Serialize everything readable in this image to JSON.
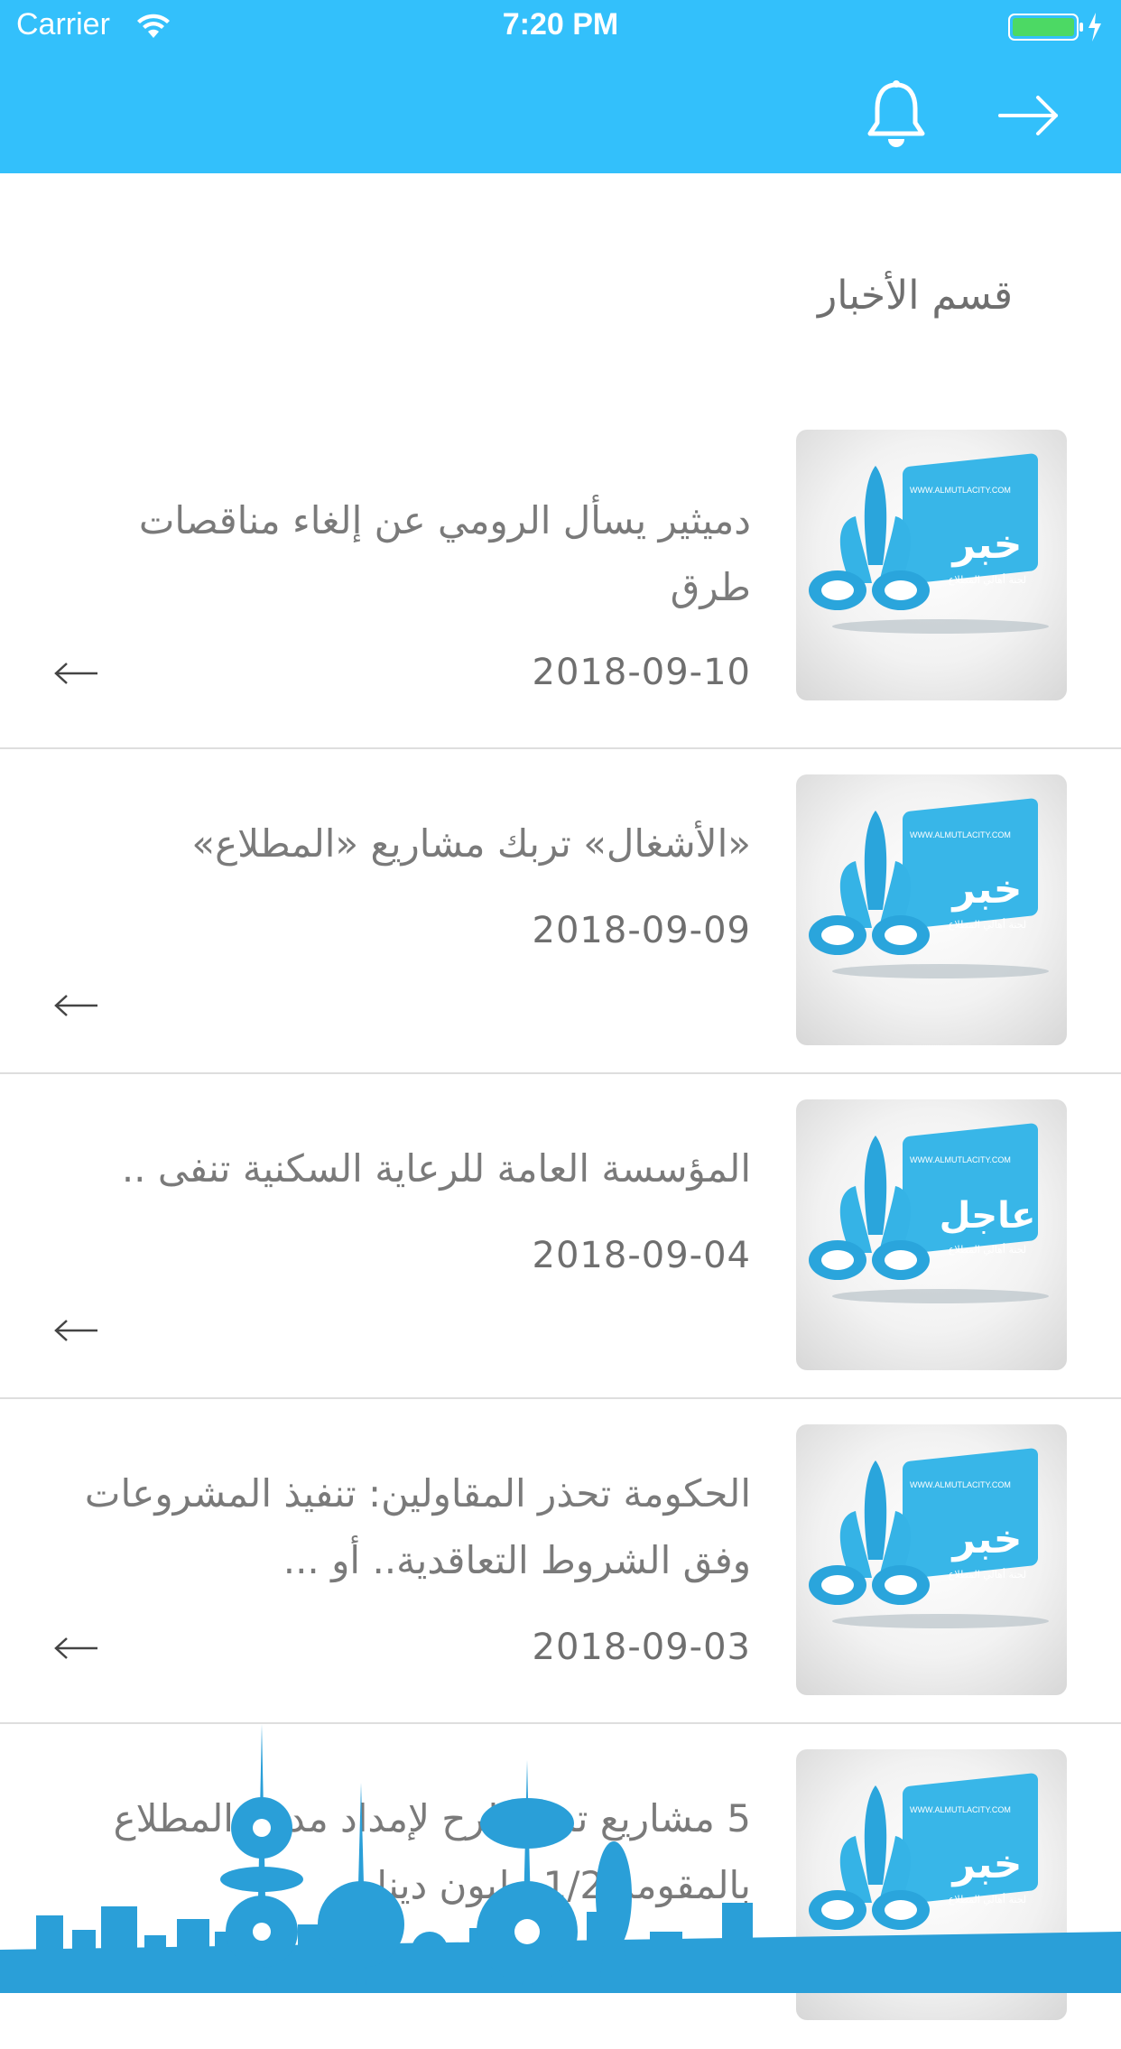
{
  "status_bar": {
    "carrier": "Carrier",
    "time": "7:20 PM"
  },
  "nav": {
    "notifications_icon": "bell-icon",
    "back_icon": "arrow-right-icon"
  },
  "section": {
    "title": "قسم الأخبار"
  },
  "news": [
    {
      "title": "دميثير يسأل الرومي عن إلغاء مناقصات طرق",
      "date": "2018-09-10",
      "thumb_text": "خبر",
      "thumb_site": "WWW.ALMUTLACITY.COM",
      "thumb_sub": "لجنة أهالي المطلاع"
    },
    {
      "title": "«الأشغال» تربك مشاريع «المطلاع»",
      "date": "2018-09-09",
      "thumb_text": "خبر",
      "thumb_site": "WWW.ALMUTLACITY.COM",
      "thumb_sub": "لجنة أهالي المطلاع"
    },
    {
      "title": "المؤسسة العامة للرعاية السكنية  تنفى ..",
      "date": "2018-09-04",
      "thumb_text": "عاجل",
      "thumb_site": "WWW.ALMUTLACITY.COM",
      "thumb_sub": "لجنة أهالي المطلاع"
    },
    {
      "title": "الحكومة تحذر المقاولين: تنفيذ المشروعات وفق الشروط التعاقدية.. أو ...",
      "date": "2018-09-03",
      "thumb_text": "خبر",
      "thumb_site": "WWW.ALMUTLACITY.COM",
      "thumb_sub": "لجنة أهالي المطلاع"
    },
    {
      "title": "5 مشاريع تم الطرح لإمداد مدينة المطلاع بالمقومة 1/2 مليون دينار",
      "date": "",
      "thumb_text": "خبر",
      "thumb_site": "WWW.ALMUTLACITY.COM",
      "thumb_sub": "لجنة أهالي المطلاع"
    }
  ],
  "colors": {
    "header": "#33c0fb",
    "skyline": "#2a9fd8",
    "text": "#7a7a7a"
  }
}
